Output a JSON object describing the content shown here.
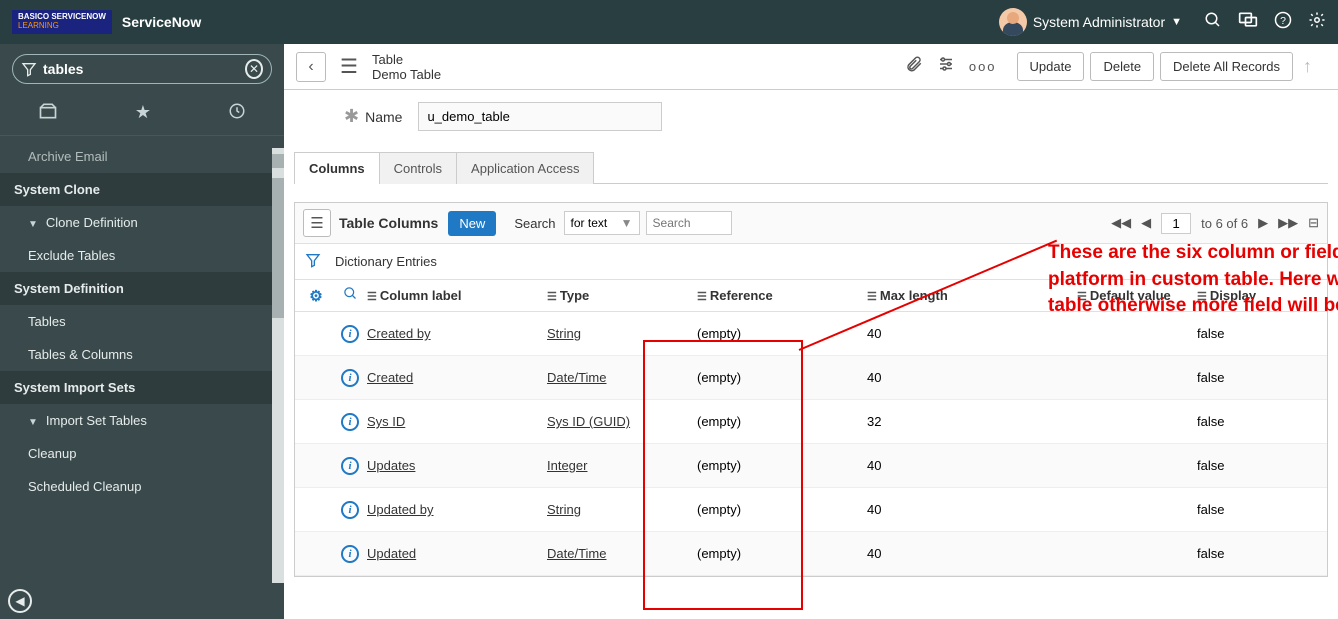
{
  "header": {
    "logo_line1": "BASICO SERVICENOW",
    "logo_line2": "LEARNING",
    "brand": "ServiceNow",
    "user_name": "System Administrator"
  },
  "sidebar": {
    "filter_value": "tables",
    "items": [
      {
        "label": "Archive Email",
        "type": "sub-cut"
      },
      {
        "label": "System Clone",
        "type": "hdr"
      },
      {
        "label": "Clone Definition",
        "type": "chev"
      },
      {
        "label": "Exclude Tables",
        "type": "sub"
      },
      {
        "label": "System Definition",
        "type": "hdr"
      },
      {
        "label": "Tables",
        "type": "sub"
      },
      {
        "label": "Tables & Columns",
        "type": "sub"
      },
      {
        "label": "System Import Sets",
        "type": "hdr"
      },
      {
        "label": "Import Set Tables",
        "type": "chev"
      },
      {
        "label": "Cleanup",
        "type": "sub"
      },
      {
        "label": "Scheduled Cleanup",
        "type": "sub"
      }
    ]
  },
  "form": {
    "title_small": "Table",
    "title_big": "Demo Table",
    "buttons": {
      "update": "Update",
      "delete": "Delete",
      "delete_all": "Delete All Records"
    },
    "name_label": "Name",
    "name_value": "u_demo_table"
  },
  "tabs": [
    "Columns",
    "Controls",
    "Application Access"
  ],
  "list": {
    "title": "Table Columns",
    "new_btn": "New",
    "search_label": "Search",
    "search_mode": "for text",
    "search_placeholder": "Search",
    "sub_header": "Dictionary Entries",
    "pagination": {
      "from": "1",
      "to": "to 6 of 6"
    },
    "columns": [
      "Column label",
      "Type",
      "Reference",
      "Max length",
      "Default value",
      "Display"
    ],
    "rows": [
      {
        "label": "Created by",
        "type": "String",
        "ref": "(empty)",
        "max": "40",
        "def": "",
        "disp": "false"
      },
      {
        "label": "Created",
        "type": "Date/Time",
        "ref": "(empty)",
        "max": "40",
        "def": "",
        "disp": "false"
      },
      {
        "label": "Sys ID",
        "type": "Sys ID (GUID)",
        "ref": "(empty)",
        "max": "32",
        "def": "",
        "disp": "false"
      },
      {
        "label": "Updates",
        "type": "Integer",
        "ref": "(empty)",
        "max": "40",
        "def": "",
        "disp": "false"
      },
      {
        "label": "Updated by",
        "type": "String",
        "ref": "(empty)",
        "max": "40",
        "def": "",
        "disp": "false"
      },
      {
        "label": "Updated",
        "type": "Date/Time",
        "ref": "(empty)",
        "max": "40",
        "def": "",
        "disp": "false"
      }
    ]
  },
  "annotation": "These are the six column or field auto created by service now platform in custom table. Here we have not extend any other table otherwise more field will be displayed here."
}
